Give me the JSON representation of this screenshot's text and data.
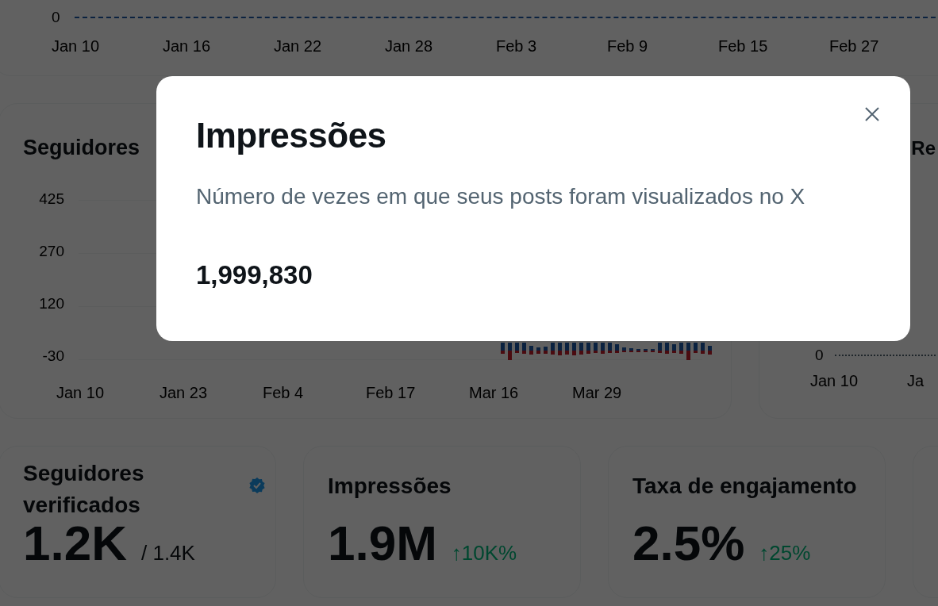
{
  "top_chart": {
    "yticks": [
      "0"
    ],
    "xlabels": [
      "Jan 10",
      "Jan 16",
      "Jan 22",
      "Jan 28",
      "Feb 3",
      "Feb 9",
      "Feb 15",
      "Feb 27"
    ]
  },
  "followers_chart": {
    "title": "Seguidores",
    "yticks": [
      "425",
      "270",
      "120",
      "-30"
    ],
    "xlabels": [
      "Jan 10",
      "Jan 23",
      "Feb 4",
      "Feb 17",
      "Mar 16",
      "Mar 29"
    ]
  },
  "side_chart": {
    "title": "Re",
    "yticks": [
      "0"
    ],
    "xlabels": [
      "Jan 10",
      "Ja"
    ]
  },
  "stats": [
    {
      "title": "Seguidores verificados",
      "value": "1.2K",
      "secondary": "/ 1.4K",
      "verified": true
    },
    {
      "title": "Impressões",
      "value": "1.9M",
      "trend": "↑10K%",
      "verified": false
    },
    {
      "title": "Taxa de engajamento",
      "value": "2.5%",
      "trend": "↑25%",
      "verified": false
    }
  ],
  "dialog": {
    "title": "Impressões",
    "description": "Número de vezes em que seus posts foram visualizados no X",
    "value": "1,999,830"
  }
}
